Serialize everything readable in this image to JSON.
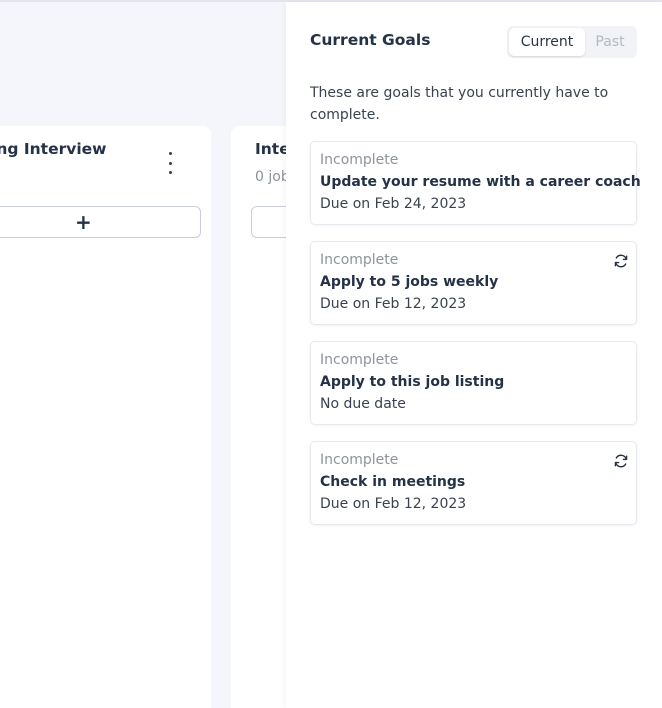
{
  "board": {
    "columns": [
      {
        "title": "ning Interview",
        "subtitle": "",
        "add_label": "+"
      },
      {
        "title": "Inte",
        "subtitle": "0 job"
      }
    ]
  },
  "goals_panel": {
    "title": "Current Goals",
    "tabs": [
      {
        "label": "Current",
        "active": true
      },
      {
        "label": "Past",
        "active": false
      }
    ],
    "description": "These are goals that you currently have to complete.",
    "goals": [
      {
        "status": "Incomplete",
        "title": "Update your resume with a career coach",
        "due": "Due on Feb 24, 2023",
        "recurring": false
      },
      {
        "status": "Incomplete",
        "title": "Apply to 5 jobs weekly",
        "due": "Due on Feb 12, 2023",
        "recurring": true
      },
      {
        "status": "Incomplete",
        "title": "Apply to this job listing",
        "due": "No due date",
        "recurring": false
      },
      {
        "status": "Incomplete",
        "title": "Check in meetings",
        "due": "Due on Feb 12, 2023",
        "recurring": true
      }
    ]
  },
  "icons": {
    "kebab": "more-vertical-icon",
    "plus": "plus-icon",
    "recurring": "refresh-icon"
  }
}
